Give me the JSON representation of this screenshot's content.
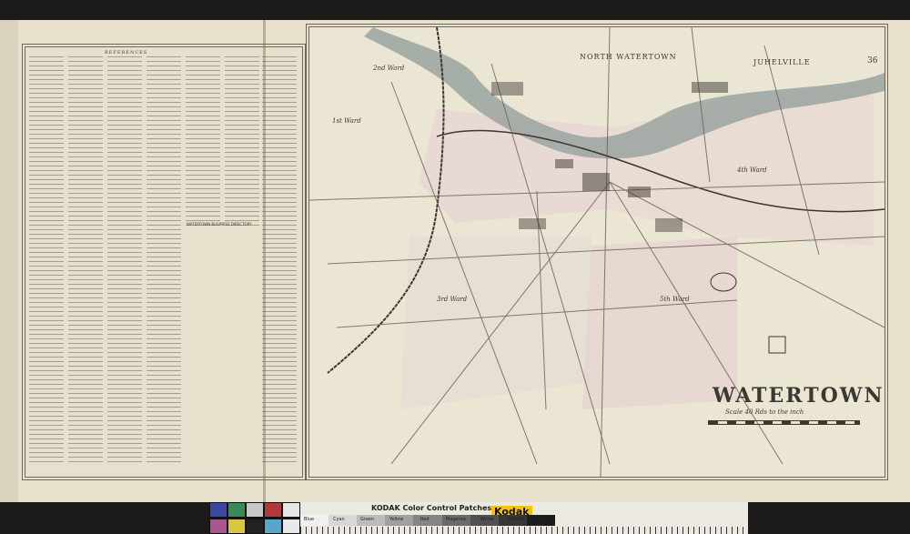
{
  "map": {
    "city_title": "WATERTOWN",
    "scale_text": "Scale 40 Rds to the inch",
    "page_number": "36",
    "places": {
      "north_watertown": "NORTH WATERTOWN",
      "juhelville": "JUHELVILLE"
    },
    "wards": {
      "ward_1": "1st Ward",
      "ward_2": "2nd Ward",
      "ward_3": "3rd Ward",
      "ward_4": "4th Ward",
      "ward_5": "5th Ward"
    },
    "directory_heading": "REFERENCES",
    "business_heading": "WATERTOWN BUSINESS DIRECTORY",
    "colors": {
      "paper": "#e6e0cc",
      "ink": "#3b3731",
      "river": "#9aa3a0",
      "ward_tint": "#e6cfd2"
    }
  },
  "target": {
    "title": "KODAK Color Control Patches",
    "brand": "Kodak",
    "patch_colors": [
      "#3a49a0",
      "#3a8a58",
      "#c8c8c8",
      "#b23a3a",
      "#e6e6e6",
      "#a8568d",
      "#d8c840",
      "#222222",
      "#5aa6c8",
      "#e8e8e8"
    ],
    "gray_steps": [
      "#f0f0f0",
      "#d8d8d8",
      "#bcbcbc",
      "#a0a0a0",
      "#848484",
      "#6a6a6a",
      "#505050",
      "#363636",
      "#1c1c1c"
    ],
    "step_labels": [
      "Blue",
      "Cyan",
      "Green",
      "Yellow",
      "Red",
      "Magenta",
      "White",
      "3/Color",
      "Black"
    ]
  }
}
